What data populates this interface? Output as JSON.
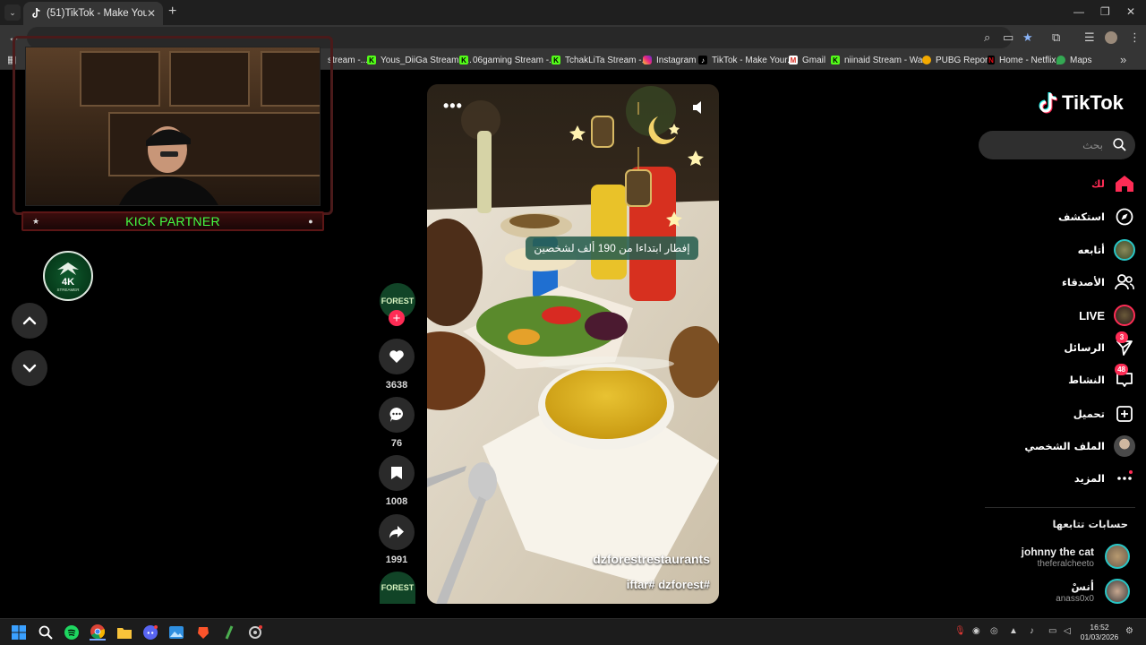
{
  "browser": {
    "tab_title": "(51)TikTok - Make Your Day",
    "tab_close": "✕",
    "new_tab": "+",
    "window_controls": [
      "—",
      "❐",
      "✕"
    ],
    "bookmarks": [
      {
        "label": "stream -...",
        "icon": "none"
      },
      {
        "label": "Yous_DiiGa Stream -...",
        "icon": "kick-icon"
      },
      {
        "label": "06gaming Stream -...",
        "icon": "kick-icon"
      },
      {
        "label": "TchakLiTa Stream -...",
        "icon": "kick-icon"
      },
      {
        "label": "Instagram",
        "icon": "instagram-icon"
      },
      {
        "label": "TikTok - Make Your...",
        "icon": "tiktok-icon"
      },
      {
        "label": "Gmail",
        "icon": "gmail-icon"
      },
      {
        "label": "niinaid Stream - Wa...",
        "icon": "kick-icon"
      },
      {
        "label": "PUBG Report",
        "icon": "pubg-icon"
      },
      {
        "label": "Home - Netflix",
        "icon": "netflix-icon"
      },
      {
        "label": "Maps",
        "icon": "maps-icon"
      }
    ],
    "bookmarks_more": "»"
  },
  "stream_overlay": {
    "kick_label": "KICK PARTNER",
    "logo_text": "4K",
    "logo_sub": "STREAMER"
  },
  "video": {
    "promo_text": "إفطار ابتداءا من 190 ألف لشخصين",
    "author": "dzforestrestaurants",
    "hashtags": "iftar# dzforest#",
    "more": "•••"
  },
  "actions": {
    "avatar_text": "FOREST",
    "likes": "3638",
    "comments": "76",
    "saves": "1008",
    "shares": "1991"
  },
  "sidebar": {
    "brand": "TikTok",
    "search_placeholder": "بحث",
    "nav": [
      {
        "label": "لك",
        "icon": "home-icon",
        "active": true
      },
      {
        "label": "استكشف",
        "icon": "compass-icon"
      },
      {
        "label": "أتابعه",
        "icon": "following-avatar-icon"
      },
      {
        "label": "الأصدقاء",
        "icon": "friends-icon"
      },
      {
        "label": "LIVE",
        "icon": "live-icon"
      },
      {
        "label": "الرسائل",
        "icon": "send-icon",
        "badge": "3"
      },
      {
        "label": "النشاط",
        "icon": "activity-icon",
        "badge": "48"
      },
      {
        "label": "تحميل",
        "icon": "upload-icon"
      },
      {
        "label": "الملف الشخصي",
        "icon": "profile-avatar-icon"
      },
      {
        "label": "المزيد",
        "icon": "more-icon"
      }
    ],
    "following_title": "حسابات تتابعها",
    "accounts": [
      {
        "name": "johnny the cat",
        "handle": "theferalcheeto"
      },
      {
        "name": "أنسْ",
        "handle": "anass0x0"
      }
    ]
  },
  "taskbar": {
    "time": "16:52",
    "date": "01/03/2026"
  },
  "colors": {
    "accent": "#fe2c55",
    "kick_green": "#44ff44",
    "teal": "#29c6c6"
  }
}
